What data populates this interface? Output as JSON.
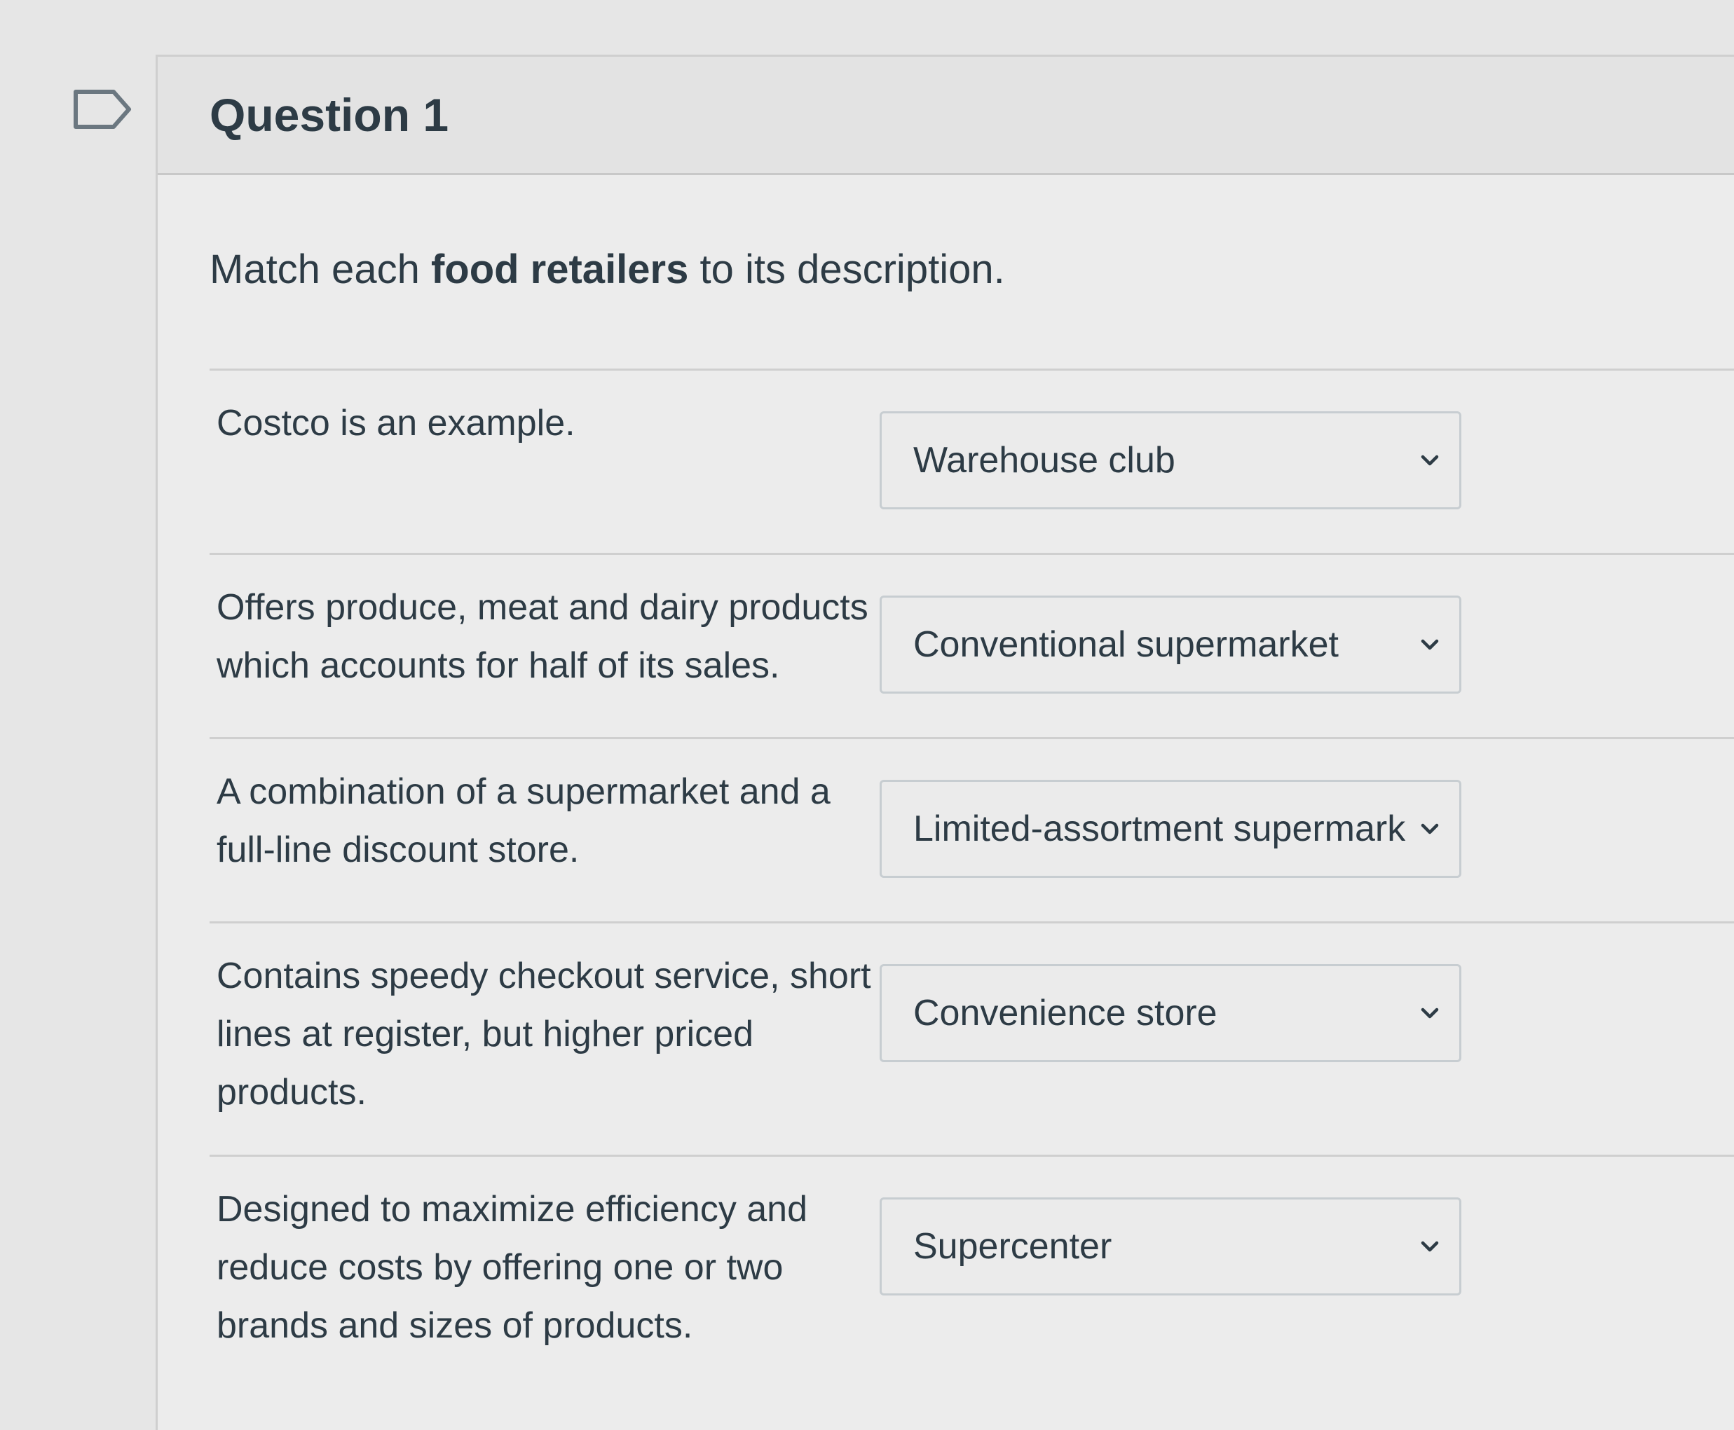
{
  "question": {
    "title": "Question 1",
    "prompt_before": "Match each ",
    "prompt_bold": "food retailers",
    "prompt_after": " to its description."
  },
  "rows": [
    {
      "description": "Costco is an example.",
      "selected": "Warehouse club"
    },
    {
      "description": "Offers produce, meat and dairy products which accounts for half of its sales.",
      "selected": "Conventional supermarket"
    },
    {
      "description": "A combination of a supermarket and a full-line discount store.",
      "selected": "Limited-assortment supermark"
    },
    {
      "description": "Contains speedy checkout service, short lines at register, but higher priced products.",
      "selected": "Convenience store"
    },
    {
      "description": "Designed to maximize efficiency and reduce costs by offering one or two brands and sizes of products.",
      "selected": "Supercenter"
    }
  ],
  "icons": {
    "flag": "flag-icon",
    "dropdown": "chevron-down-icon"
  }
}
